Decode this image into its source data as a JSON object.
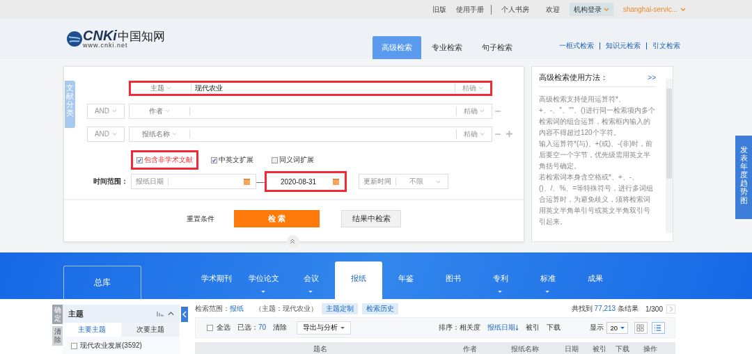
{
  "top_bar": {
    "links": [
      "旧版",
      "使用手册",
      "个人书房"
    ],
    "welcome": "欢迎",
    "login_button": "机构登录",
    "account": "shanghai-servic..."
  },
  "logo": {
    "brand": "CNKi",
    "name": "中国知网",
    "url": "www.cnki.net"
  },
  "search_modes": [
    {
      "label": "高级检索",
      "selected": true
    },
    {
      "label": "专业检索",
      "selected": false
    },
    {
      "label": "句子检索",
      "selected": false
    }
  ],
  "other_searches": [
    "一框式检索",
    "知识元检索",
    "引文检索"
  ],
  "side_tab": "文献分类",
  "rows": [
    {
      "field": "主题",
      "value": "现代农业",
      "match": "精确",
      "highlighted": true,
      "removable": false,
      "addable": false
    },
    {
      "operator": "AND",
      "field": "作者",
      "match": "精确",
      "highlighted": false,
      "removable": true,
      "addable": false
    },
    {
      "operator": "AND",
      "field": "报纸名称",
      "match": "精确",
      "highlighted": false,
      "removable": true,
      "addable": true
    }
  ],
  "options": [
    {
      "label": "包含非学术文献",
      "checked": true,
      "highlighted": true
    },
    {
      "label": "中英文扩展",
      "checked": true,
      "highlighted": false
    },
    {
      "label": "同义词扩展",
      "checked": false,
      "highlighted": false
    }
  ],
  "time": {
    "label": "时间范围：",
    "date_field": "报纸日期",
    "separator": "—",
    "to": "2020-08-31",
    "to_highlighted": true,
    "update_field": "更新时间",
    "update_value": "不限"
  },
  "actions": {
    "reset": "重置条件",
    "search": "检 索",
    "search_within": "结果中检索"
  },
  "help": {
    "title": "高级检索使用方法：",
    "more": ">>",
    "paragraphs": [
      "高级检索支持使用运算符*、+、-、''、\"\"、()进行同一检索项内多个检索词的组合运算，检索框内输入的内容不得超过120个字符。",
      "输入运算符*(与)、+(或)、-(非)时，前后要空一个字节，优先级需用英文半角括号确定。",
      "若检索词本身含空格或*、+、-、()、/、%、=等特殊符号，进行多词组合运算时，为避免歧义，须将检索词用英文半角单引号或英文半角双引号引起来。"
    ]
  },
  "trend_tab": "发表年度趋势图",
  "databases": {
    "all": "总库",
    "tabs": [
      {
        "label": "学术期刊",
        "selected": false,
        "has_menu": false
      },
      {
        "label": "学位论文",
        "selected": false,
        "has_menu": true
      },
      {
        "label": "会议",
        "selected": false,
        "has_menu": true
      },
      {
        "label": "报纸",
        "selected": true,
        "has_menu": false
      },
      {
        "label": "年鉴",
        "selected": false,
        "has_menu": false
      },
      {
        "label": "图书",
        "selected": false,
        "has_menu": false
      },
      {
        "label": "专利",
        "selected": false,
        "has_menu": true
      },
      {
        "label": "标准",
        "selected": false,
        "has_menu": true
      },
      {
        "label": "成果",
        "selected": false,
        "has_menu": false
      }
    ]
  },
  "filter": {
    "confirm": "确定",
    "clear": "清除",
    "title": "主题",
    "tabs": [
      {
        "label": "主要主题",
        "selected": true
      },
      {
        "label": "次要主题",
        "selected": false
      }
    ],
    "items": [
      {
        "label": "现代农业发展(3592)",
        "checked": false
      }
    ]
  },
  "results": {
    "scope_label": "检索范围：",
    "scope": "报纸",
    "query": "（主题：现代农业）",
    "buttons": [
      "主题定制",
      "检索历史"
    ],
    "found_label": "共找到",
    "count": "77,213",
    "found_suffix": "条结果",
    "page": "1/300",
    "select_all": "全选",
    "select_all_checked": false,
    "selected_label": "已选：",
    "selected_count": "70",
    "clear": "清除",
    "export": "导出与分析",
    "sort_label": "排序：",
    "sorts": [
      {
        "label": "相关度",
        "selected": false
      },
      {
        "label": "报纸日期",
        "selected": true
      },
      {
        "label": "被引",
        "selected": false
      },
      {
        "label": "下载",
        "selected": false
      }
    ],
    "show_label": "显示",
    "page_size": "20",
    "views": [
      {
        "kind": "grid",
        "selected": false
      },
      {
        "kind": "list",
        "selected": true
      }
    ],
    "columns": [
      "题名",
      "作者",
      "报纸名称",
      "日期",
      "被引",
      "下载",
      "操作"
    ]
  }
}
